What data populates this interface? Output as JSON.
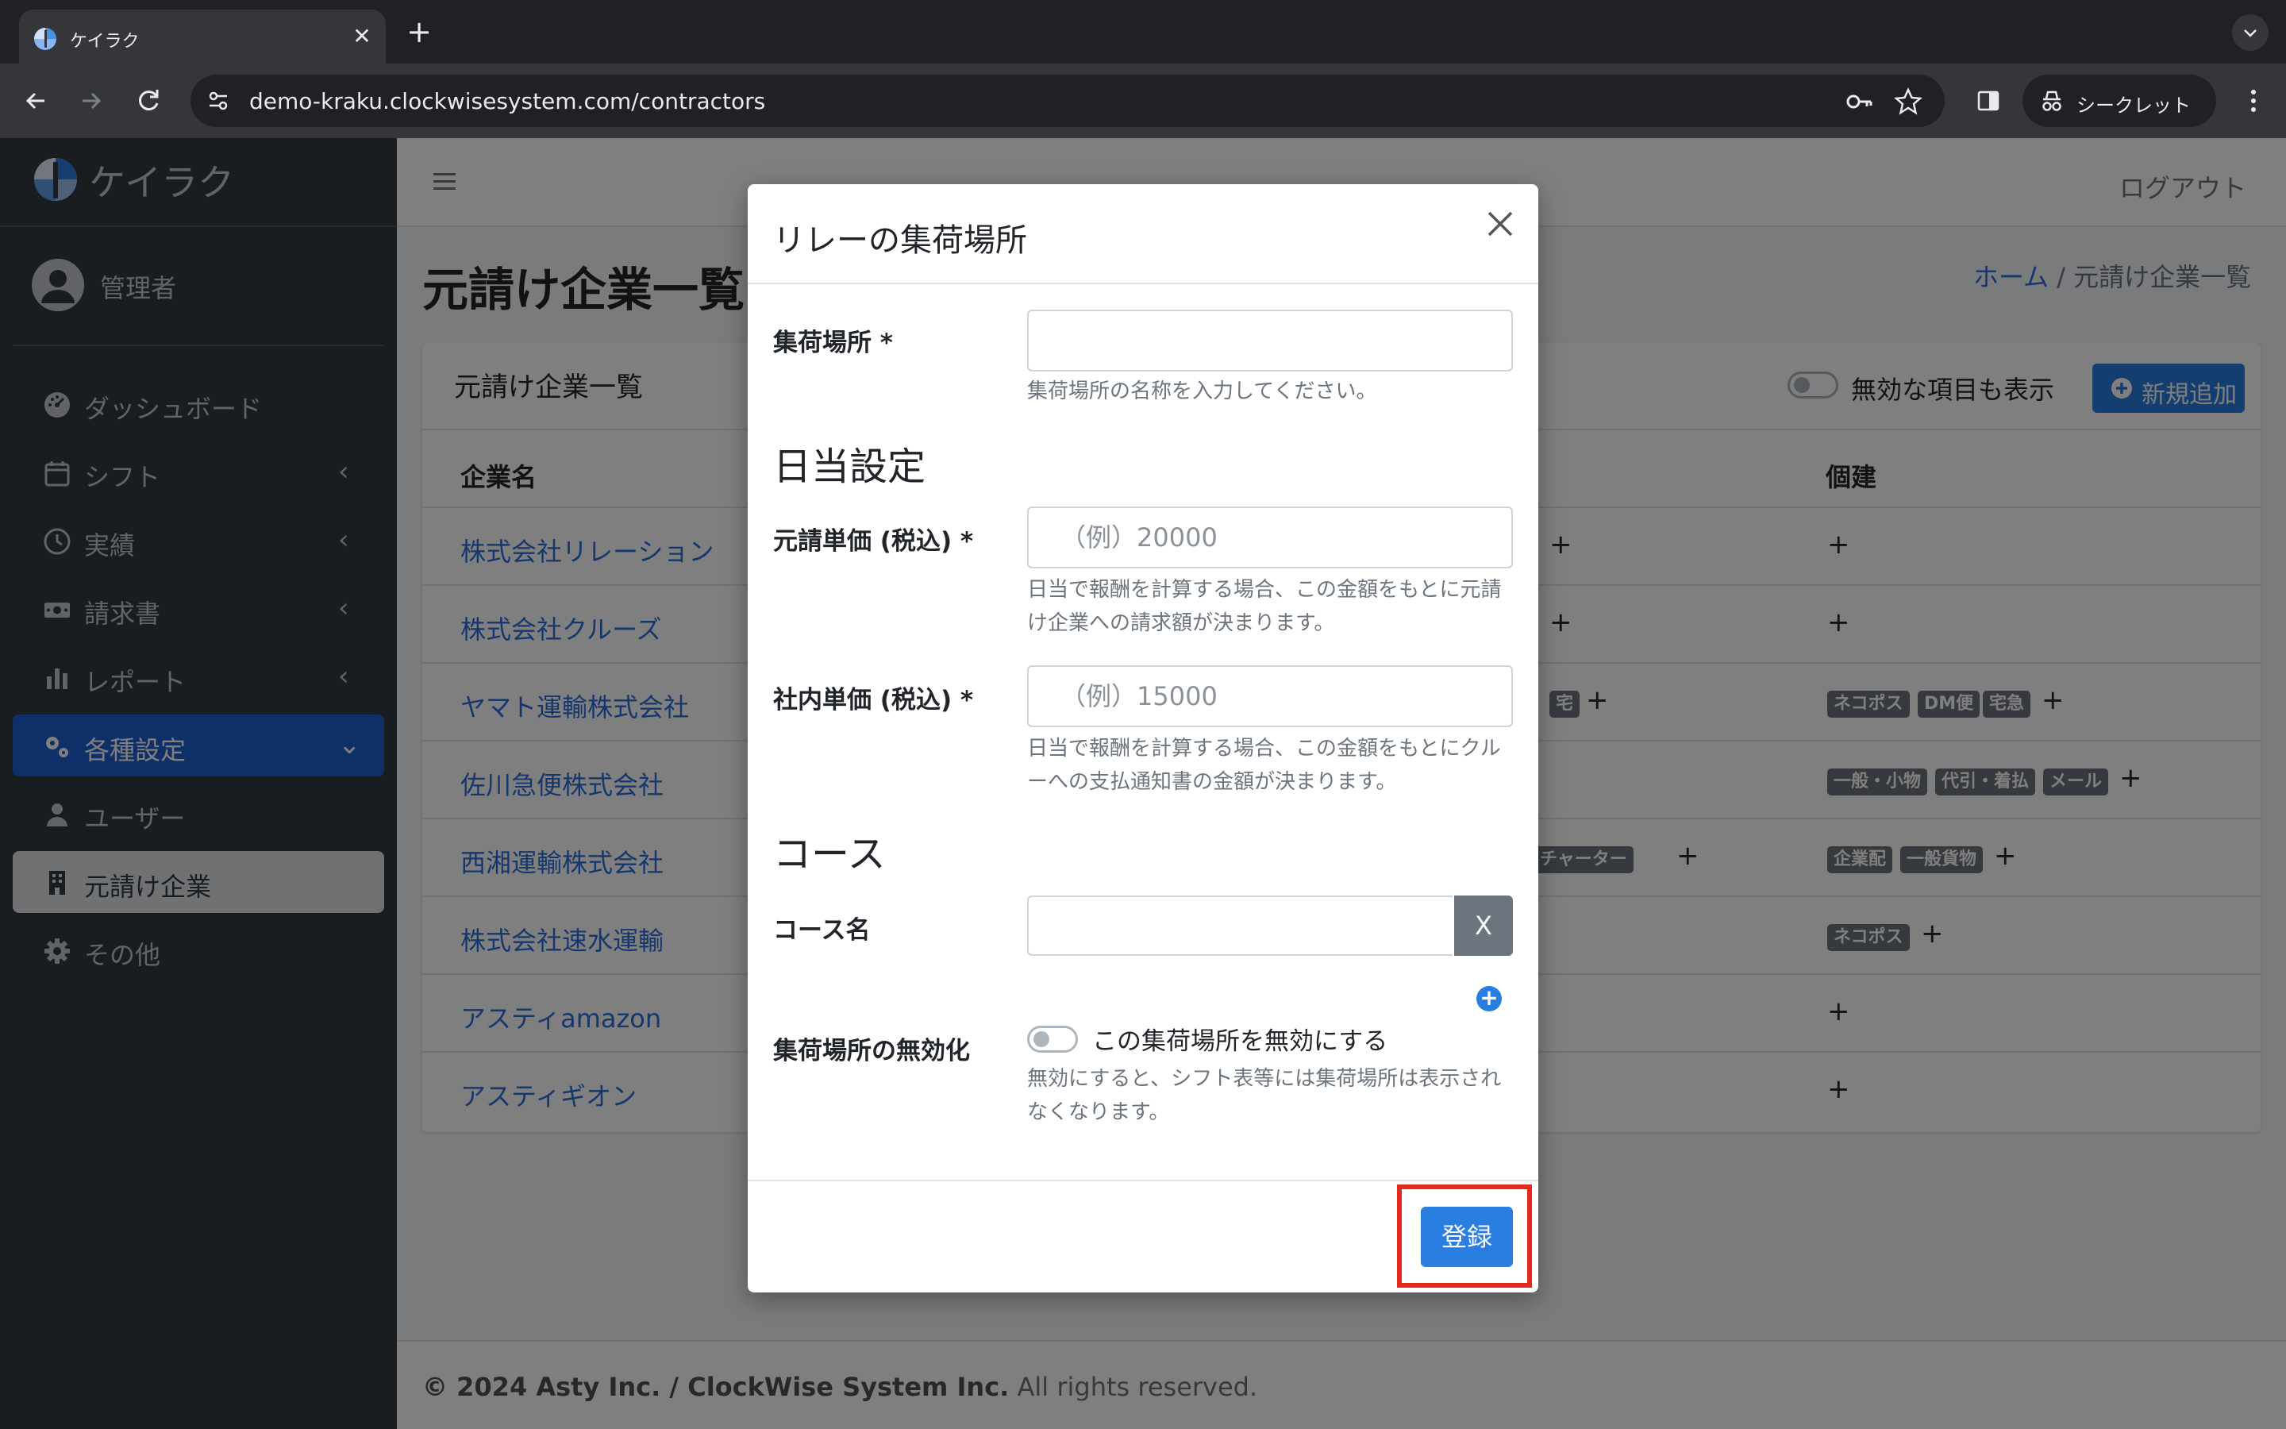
{
  "browser": {
    "tab_title": "ケイラク",
    "tab_close": "✕",
    "new_tab": "+",
    "url": "demo-kraku.clockwisesystem.com/contractors",
    "incognito_label": "シークレット"
  },
  "app": {
    "brand": "ケイラク",
    "user_name": "管理者",
    "logout": "ログアウト",
    "sidebar": [
      {
        "label": "ダッシュボード",
        "icon": "dashboard-icon",
        "arrow": ""
      },
      {
        "label": "シフト",
        "icon": "calendar-icon",
        "arrow": "‹"
      },
      {
        "label": "実績",
        "icon": "clock-icon",
        "arrow": "‹"
      },
      {
        "label": "請求書",
        "icon": "money-icon",
        "arrow": "‹"
      },
      {
        "label": "レポート",
        "icon": "chart-icon",
        "arrow": "‹"
      },
      {
        "label": "各種設定",
        "icon": "gears-icon",
        "arrow": "⌄"
      },
      {
        "label": "ユーザー",
        "icon": "user-icon",
        "arrow": ""
      },
      {
        "label": "元請け企業",
        "icon": "building-icon",
        "arrow": ""
      },
      {
        "label": "その他",
        "icon": "gear-icon",
        "arrow": ""
      }
    ],
    "page_title": "元請け企業一覧",
    "breadcrumb": {
      "home": "ホーム",
      "separator": " / ",
      "current": "元請け企業一覧"
    },
    "card_title": "元請け企業一覧",
    "show_inactive_label": "無効な項目も表示",
    "new_button": "新規追加",
    "table": {
      "header_company": "企業名",
      "header_kodate": "個建",
      "rows": [
        {
          "name": "株式会社リレーション",
          "mid_badges": [],
          "right_badges": []
        },
        {
          "name": "株式会社クルーズ",
          "mid_badges": [],
          "right_badges": []
        },
        {
          "name": "ヤマト運輸株式会社",
          "mid_badges": [
            "宅"
          ],
          "right_badges": [
            "ネコポス",
            "DM便",
            "宅急"
          ]
        },
        {
          "name": "佐川急便株式会社",
          "mid_badges": [],
          "right_badges": [
            "一般・小物",
            "代引・着払",
            "メール"
          ]
        },
        {
          "name": "西湘運輸株式会社",
          "mid_badges": [
            "チャーター"
          ],
          "right_badges": [
            "企業配",
            "一般貨物"
          ]
        },
        {
          "name": "株式会社速水運輸",
          "mid_badges": [],
          "right_badges": [
            "ネコポス"
          ]
        },
        {
          "name": "アスティamazon",
          "mid_badges": [],
          "right_badges": []
        },
        {
          "name": "アスティギオン",
          "mid_badges": [],
          "right_badges": []
        }
      ],
      "plus": "+"
    },
    "footer": {
      "copyright": "© 2024 Asty Inc. / ClockWise System Inc.",
      "rights": " All rights reserved."
    }
  },
  "modal": {
    "title": "リレーの集荷場所",
    "pickup_label": "集荷場所 *",
    "pickup_value": "",
    "pickup_help": "集荷場所の名称を入力してください。",
    "daily_heading": "日当設定",
    "contract_price_label": "元請単価 (税込) *",
    "contract_price_placeholder": "（例）20000",
    "contract_price_help": "日当で報酬を計算する場合、この金額をもとに元請け企業への請求額が決まります。",
    "internal_price_label": "社内単価 (税込) *",
    "internal_price_placeholder": "（例）15000",
    "internal_price_help": "日当で報酬を計算する場合、この金額をもとにクルーへの支払通知書の金額が決まります。",
    "course_heading": "コース",
    "course_name_label": "コース名",
    "course_remove": "X",
    "course_add": "+",
    "disable_label": "集荷場所の無効化",
    "disable_switch_label": "この集荷場所を無効にする",
    "disable_help": "無効にすると、シフト表等には集荷場所は表示されなくなります。",
    "submit": "登録"
  },
  "colors": {
    "primary": "#2a7de1",
    "sidebar": "#343a40",
    "highlight": "#e3291b"
  }
}
